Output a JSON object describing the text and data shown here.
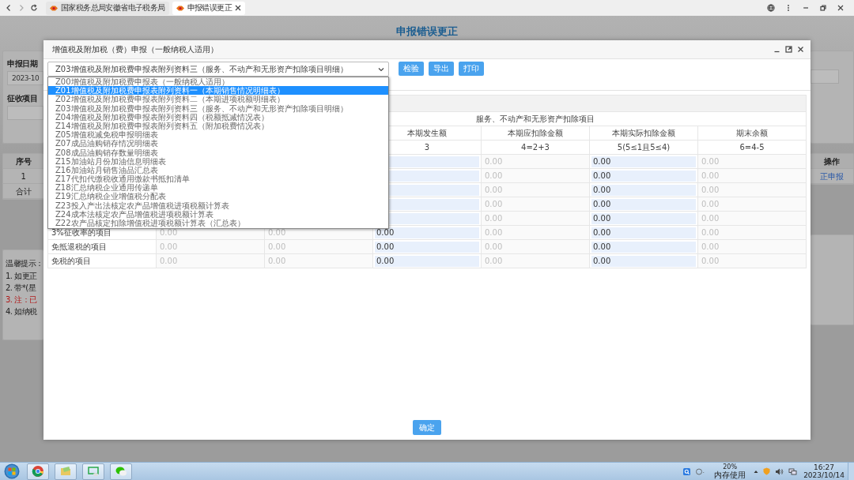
{
  "browser": {
    "tabs": [
      {
        "title": "国家税务总局安徽省电子税务局",
        "selected": false
      },
      {
        "title": "申报错误更正",
        "selected": true
      }
    ]
  },
  "page": {
    "title": "申报错误更正",
    "date_label": "申报日期",
    "date_value": "2023-10",
    "item_label": "征收项目",
    "table": {
      "index_header": "序号",
      "index_rows": [
        "1",
        "合计"
      ],
      "action_header": "操作",
      "action_link": "正申报"
    },
    "tips": [
      {
        "text": "温馨提示：",
        "kind": "heading"
      },
      {
        "text": "1. 如更正",
        "kind": "normal"
      },
      {
        "text": "2. 带*(星",
        "kind": "normal"
      },
      {
        "text": "3. 注：已",
        "kind": "warning"
      },
      {
        "text": "4. 如纳税",
        "kind": "normal"
      }
    ]
  },
  "dialog": {
    "title": "增值税及附加税（费）申报（一般纳税人适用）",
    "select": {
      "value": "Z03增值税及附加税费申报表附列资料三（服务、不动产和无形资产扣除项目明细）"
    },
    "buttons": [
      "检验",
      "导出",
      "打印"
    ],
    "options": [
      {
        "label": "Z00增值税及附加税费申报表（一般纳税人适用）",
        "selected": false
      },
      {
        "label": "Z01增值税及附加税费申报表附列资料一（本期销售情况明细表）",
        "selected": true
      },
      {
        "label": "Z02增值税及附加税费申报表附列资料二（本期进项税额明细表）",
        "selected": false
      },
      {
        "label": "Z03增值税及附加税费申报表附列资料三（服务、不动产和无形资产扣除项目明细）",
        "selected": false
      },
      {
        "label": "Z04增值税及附加税费申报表附列资料四（税额抵减情况表）",
        "selected": false
      },
      {
        "label": "Z14增值税及附加税费申报表附列资料五（附加税费情况表）",
        "selected": false
      },
      {
        "label": "Z05增值税减免税申报明细表",
        "selected": false
      },
      {
        "label": "Z07成品油购销存情况明细表",
        "selected": false
      },
      {
        "label": "Z08成品油购销存数量明细表",
        "selected": false
      },
      {
        "label": "Z15加油站月份加油信息明细表",
        "selected": false
      },
      {
        "label": "Z16加油站月销售油品汇总表",
        "selected": false
      },
      {
        "label": "Z17代扣代缴税收通用缴款书抵扣清单",
        "selected": false
      },
      {
        "label": "Z18汇总纳税企业通用传递单",
        "selected": false
      },
      {
        "label": "Z19汇总纳税企业增值税分配表",
        "selected": false
      },
      {
        "label": "Z23投入产出法核定农产品增值税进项税额计算表",
        "selected": false
      },
      {
        "label": "Z24成本法核定农产品增值税进项税额计算表",
        "selected": false
      },
      {
        "label": "Z22农产品核定扣除增值税进项税额计算表（汇总表）",
        "selected": false
      }
    ],
    "table": {
      "group_header": "服务、不动产和无形资产扣除项目",
      "headers": [
        "本期发生额",
        "本期应扣除金额",
        "本期实际扣除金额",
        "期末余额"
      ],
      "numbers": [
        "3",
        "4=2+3",
        "5(5≤1且5≤4)",
        "6=4-5"
      ],
      "rows": [
        {
          "cells": [
            {
              "kind": "input"
            },
            {
              "kind": "readonly",
              "value": "0.00"
            },
            {
              "kind": "input",
              "value": "0.00"
            },
            {
              "kind": "readonly",
              "value": "0.00"
            }
          ]
        },
        {
          "cells": [
            {
              "kind": "input"
            },
            {
              "kind": "readonly",
              "value": "0.00"
            },
            {
              "kind": "input",
              "value": "0.00"
            },
            {
              "kind": "readonly",
              "value": "0.00"
            }
          ]
        },
        {
          "cells": [
            {
              "kind": "input"
            },
            {
              "kind": "readonly",
              "value": "0.00"
            },
            {
              "kind": "input",
              "value": "0.00"
            },
            {
              "kind": "readonly",
              "value": "0.00"
            }
          ]
        },
        {
          "cells": [
            {
              "kind": "input"
            },
            {
              "kind": "readonly",
              "value": "0.00"
            },
            {
              "kind": "input",
              "value": "0.00"
            },
            {
              "kind": "readonly",
              "value": "0.00"
            }
          ]
        },
        {
          "cells": [
            {
              "kind": "input"
            },
            {
              "kind": "readonly",
              "value": "0.00"
            },
            {
              "kind": "input",
              "value": "0.00"
            },
            {
              "kind": "readonly",
              "value": "0.00"
            }
          ]
        },
        {
          "label": "3%征收率的项目",
          "cells": [
            {
              "kind": "readonly",
              "value": "0.00"
            },
            {
              "kind": "readonly",
              "value": "0.00"
            },
            {
              "kind": "input",
              "value": "0.00"
            },
            {
              "kind": "readonly",
              "value": "0.00"
            },
            {
              "kind": "input",
              "value": "0.00"
            },
            {
              "kind": "readonly",
              "value": "0.00"
            }
          ]
        },
        {
          "label": "免抵退税的项目",
          "cells": [
            {
              "kind": "readonly",
              "value": "0.00"
            },
            {
              "kind": "readonly",
              "value": "0.00"
            },
            {
              "kind": "input",
              "value": "0.00"
            },
            {
              "kind": "readonly",
              "value": "0.00"
            },
            {
              "kind": "input",
              "value": "0.00"
            },
            {
              "kind": "readonly",
              "value": "0.00"
            }
          ]
        },
        {
          "label": "免税的项目",
          "cells": [
            {
              "kind": "readonly",
              "value": "0.00"
            },
            {
              "kind": "readonly",
              "value": "0.00"
            },
            {
              "kind": "input",
              "value": "0.00"
            },
            {
              "kind": "readonly",
              "value": "0.00"
            },
            {
              "kind": "input",
              "value": "0.00"
            },
            {
              "kind": "readonly",
              "value": "0.00"
            }
          ]
        }
      ]
    },
    "confirm": "确定"
  },
  "taskbar": {
    "memory_percent": "20%",
    "memory_label": "内存使用",
    "time": "16:27",
    "date": "2023/10/14"
  }
}
